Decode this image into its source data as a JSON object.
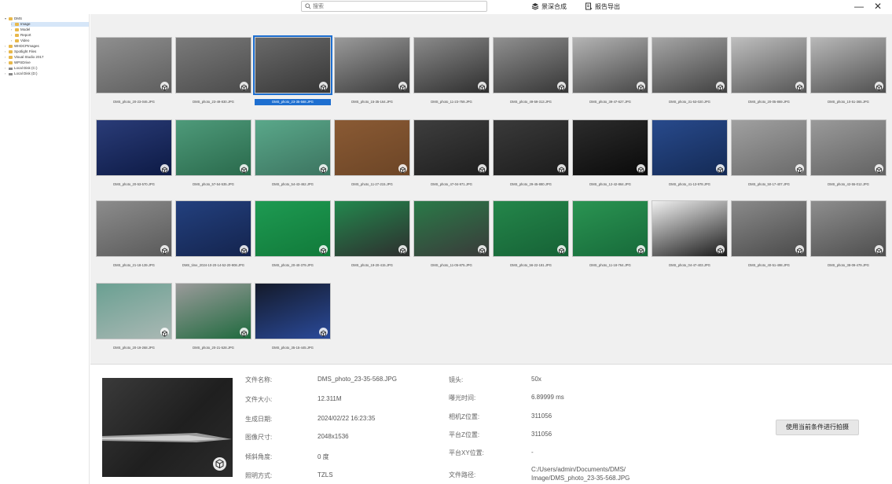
{
  "search": {
    "placeholder": "搜索"
  },
  "toolbar": {
    "merge_label": "景深合成",
    "export_label": "报告导出"
  },
  "window": {
    "minimize": "—",
    "close": "✕"
  },
  "sidebar": {
    "items": [
      {
        "label": "DMS",
        "kind": "folder"
      },
      {
        "label": "Image",
        "kind": "folder",
        "selected": true
      },
      {
        "label": "Model",
        "kind": "folder"
      },
      {
        "label": "Report",
        "kind": "folder"
      },
      {
        "label": "Video",
        "kind": "folder"
      },
      {
        "label": "WHDCPImages",
        "kind": "folder"
      },
      {
        "label": "Spotlight Files",
        "kind": "folder"
      },
      {
        "label": "Visual Studio 2017",
        "kind": "folder"
      },
      {
        "label": "WPSDrive",
        "kind": "folder"
      },
      {
        "label": "Local Disk (C:)",
        "kind": "drive"
      },
      {
        "label": "Local Disk (D:)",
        "kind": "drive"
      }
    ]
  },
  "gallery": {
    "items": [
      {
        "caption": "DMS_photo_20-23-046.JPG",
        "colors": [
          "#8f8f8f",
          "#5e5e5e"
        ]
      },
      {
        "caption": "DMS_photo_23-49-830.JPG",
        "colors": [
          "#7a7a7a",
          "#4b4b4b"
        ]
      },
      {
        "caption": "DMS_photo_23-35-568.JPG",
        "colors": [
          "#6a6a6a",
          "#363636"
        ],
        "selected": true
      },
      {
        "caption": "DMS_photo_15-35-164.JPG",
        "colors": [
          "#9a9a9a",
          "#3a3a3a"
        ]
      },
      {
        "caption": "DMS_photo_11-23-759.JPG",
        "colors": [
          "#8b8b8b",
          "#2e2e2e"
        ]
      },
      {
        "caption": "DMS_photo_49-59-313.JPG",
        "colors": [
          "#909090",
          "#363636"
        ]
      },
      {
        "caption": "DMS_photo_39-47-627.JPG",
        "colors": [
          "#b4b4b4",
          "#474747"
        ]
      },
      {
        "caption": "DMS_photo_31-53-020.JPG",
        "colors": [
          "#a6a6a6",
          "#414141"
        ]
      },
      {
        "caption": "DMS_photo_20-05-869.JPG",
        "colors": [
          "#bebebe",
          "#565656"
        ]
      },
      {
        "caption": "DMS_photo_10-51-365.JPG",
        "colors": [
          "#b8b8b8",
          "#505050"
        ]
      },
      {
        "caption": "DMS_photo_20-53-570.JPG",
        "colors": [
          "#2a3c78",
          "#0d1a45"
        ]
      },
      {
        "caption": "DMS_photo_57-54-535.JPG",
        "colors": [
          "#4e9a7a",
          "#2a6a4c"
        ]
      },
      {
        "caption": "DMS_photo_54-43-462.JPG",
        "colors": [
          "#5aa88a",
          "#3c7460"
        ]
      },
      {
        "caption": "DMS_photo_11-27-215.JPG",
        "colors": [
          "#8a5a34",
          "#6c4526"
        ]
      },
      {
        "caption": "DMS_photo_47-04-971.JPG",
        "colors": [
          "#3e3e3e",
          "#1e1e1e"
        ]
      },
      {
        "caption": "DMS_photo_29-45-880.JPG",
        "colors": [
          "#3a3a3a",
          "#1c1c1c"
        ]
      },
      {
        "caption": "DMS_photo_12-42-864.JPG",
        "colors": [
          "#2c2c2c",
          "#0a0a0a"
        ]
      },
      {
        "caption": "DMS_photo_41-13-978.JPG",
        "colors": [
          "#284a8c",
          "#142a55"
        ]
      },
      {
        "caption": "DMS_photo_50-17-407.JPG",
        "colors": [
          "#a0a0a0",
          "#6a6a6a"
        ]
      },
      {
        "caption": "DMS_photo_42-55-012.JPG",
        "colors": [
          "#9a9a9a",
          "#626262"
        ]
      },
      {
        "caption": "DMS_photo_21-18-139.JPG",
        "colors": [
          "#8c8c8c",
          "#5a5a5a"
        ]
      },
      {
        "caption": "DMS_time_2024-10-20-14-52-20-908.JPG",
        "colors": [
          "#23407e",
          "#14244e"
        ]
      },
      {
        "caption": "DMS_photo_20-40-379.JPG",
        "colors": [
          "#1e9a52",
          "#117a3a"
        ]
      },
      {
        "caption": "DMS_photo_19-20-415.JPG",
        "colors": [
          "#23884e",
          "#2e2e2e"
        ]
      },
      {
        "caption": "DMS_photo_11-05-875.JPG",
        "colors": [
          "#2a7a48",
          "#3a3a3a"
        ]
      },
      {
        "caption": "DMS_photo_56-22-181.JPG",
        "colors": [
          "#24864a",
          "#166236"
        ]
      },
      {
        "caption": "DMS_photo_11-18-764.JPG",
        "colors": [
          "#2a9452",
          "#176a3a"
        ]
      },
      {
        "caption": "DMS_photo_04-47-403.JPG",
        "colors": [
          "#f0f0f0",
          "#1a1a1a"
        ]
      },
      {
        "caption": "DMS_photo_40-51-498.JPG",
        "colors": [
          "#8a8a8a",
          "#4a4a4a"
        ]
      },
      {
        "caption": "DMS_photo_38-09-479.JPG",
        "colors": [
          "#8e8e8e",
          "#4e4e4e"
        ]
      },
      {
        "caption": "DMS_photo_20-19-268.JPG",
        "colors": [
          "#6aa092",
          "#aab8b4"
        ]
      },
      {
        "caption": "DMS_photo_20-21-528.JPG",
        "colors": [
          "#9a9a9a",
          "#1f6a3e"
        ]
      },
      {
        "caption": "DMS_photo_35-15-445.JPG",
        "colors": [
          "#141a2a",
          "#2a4a9a"
        ]
      }
    ]
  },
  "details": {
    "col1": [
      {
        "label": "文件名称:",
        "value": "DMS_photo_23-35-568.JPG"
      },
      {
        "label": "文件大小:",
        "value": "12.311M"
      },
      {
        "label": "生成日期:",
        "value": "2024/02/22 16:23:35"
      },
      {
        "label": "图像尺寸:",
        "value": "2048x1536"
      },
      {
        "label": "倾斜角度:",
        "value": "0 度"
      },
      {
        "label": "照明方式:",
        "value": "TZLS"
      }
    ],
    "col2": [
      {
        "label": "镜头:",
        "value": "50x"
      },
      {
        "label": "曝光时间:",
        "value": "6.89999 ms"
      },
      {
        "label": "相机Z位置:",
        "value": "311056"
      },
      {
        "label": "平台Z位置:",
        "value": "311056"
      },
      {
        "label": "平台XY位置:",
        "value": "-"
      },
      {
        "label": "文件路径:",
        "value": "C:/Users/admin/Documents/DMS/",
        "value2": "Image/DMS_photo_23-35-568.JPG"
      }
    ],
    "scan_button": "使用当前条件进行拍摄"
  }
}
